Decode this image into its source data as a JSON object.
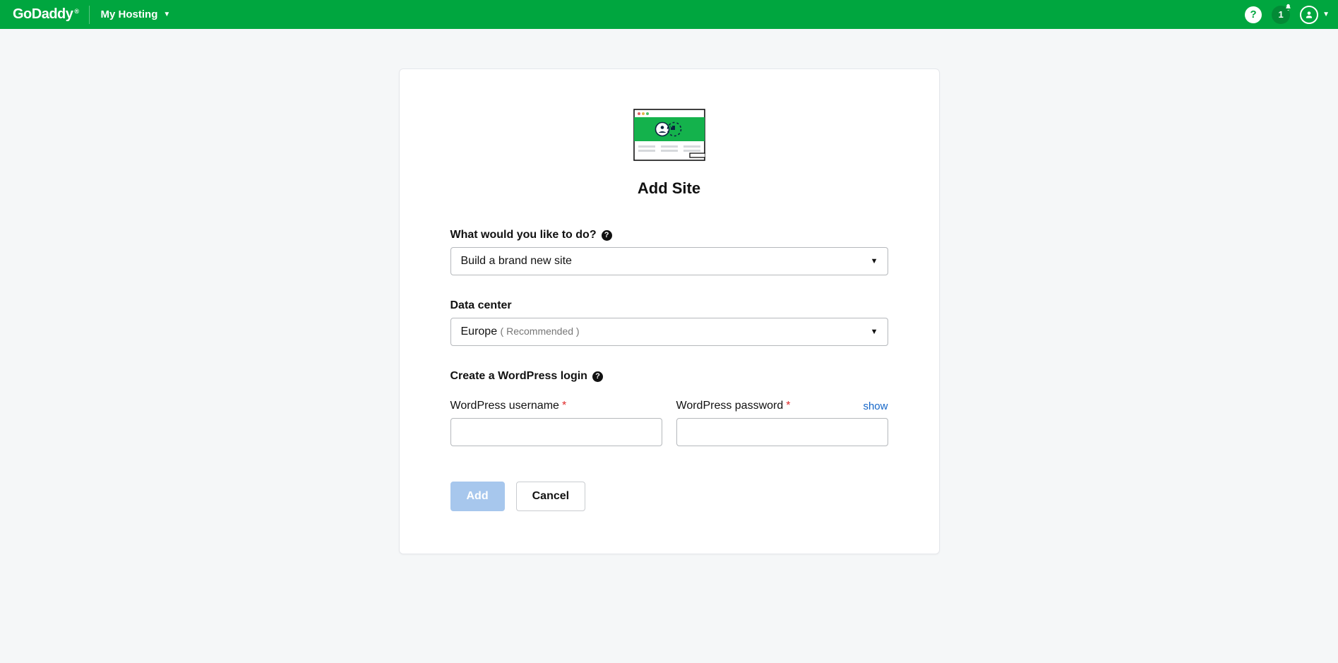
{
  "header": {
    "brand": "GoDaddy",
    "nav_item": "My Hosting",
    "notification_count": "1"
  },
  "card": {
    "title": "Add Site"
  },
  "what_do": {
    "label": "What would you like to do?",
    "selected": "Build a brand new site"
  },
  "datacenter": {
    "label": "Data center",
    "selected": "Europe",
    "hint": "( Recommended )"
  },
  "wp_login": {
    "section_label": "Create a WordPress login",
    "username_label": "WordPress username",
    "password_label": "WordPress password",
    "show_link": "show",
    "username_value": "",
    "password_value": ""
  },
  "buttons": {
    "add": "Add",
    "cancel": "Cancel"
  }
}
